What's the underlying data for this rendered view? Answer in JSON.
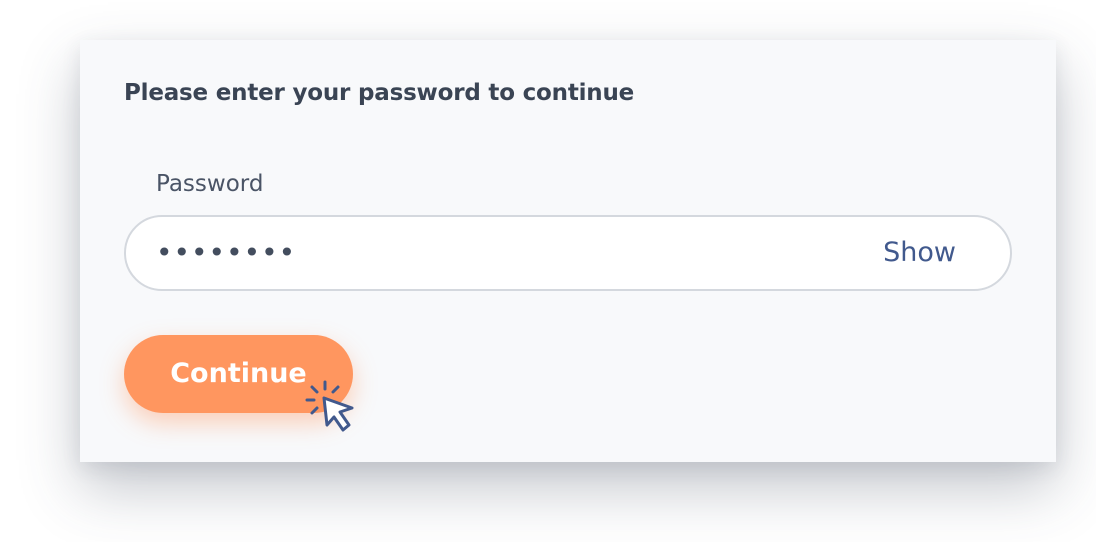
{
  "dialog": {
    "heading": "Please enter your password to continue",
    "password_label": "Password",
    "password_value": "••••••••",
    "show_label": "Show",
    "continue_label": "Continue"
  },
  "icons": {
    "cursor": "pointer-cursor-icon"
  },
  "colors": {
    "card_background": "#f8f9fb",
    "primary_button": "#ff965f",
    "show_link": "#41598d",
    "text": "#3a4454",
    "input_border": "#d4d8de"
  }
}
